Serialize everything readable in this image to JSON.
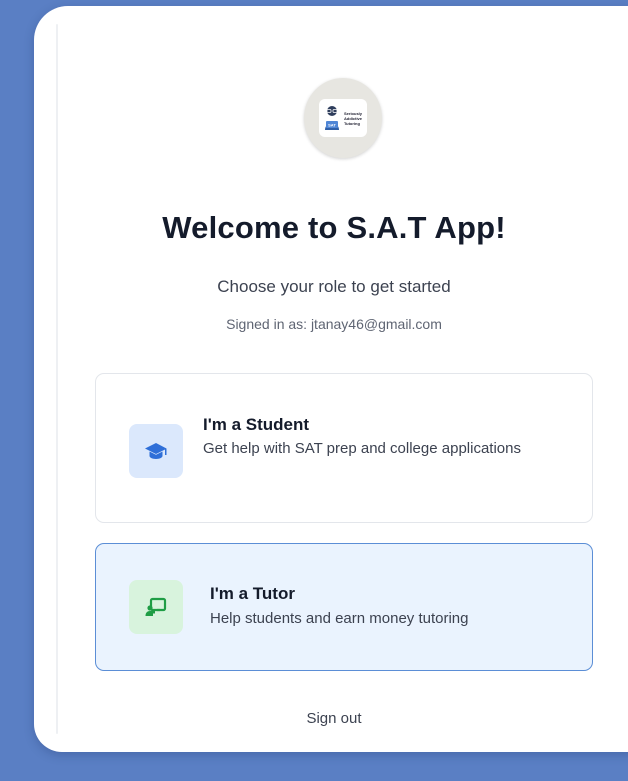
{
  "logo": {
    "text_line1": "Seriously",
    "text_line2": "Addictive",
    "text_line3": "Tutoring",
    "badge": "SAT"
  },
  "header": {
    "title": "Welcome to S.A.T App!",
    "subtitle": "Choose your role to get started",
    "signed_in": "Signed in as: jtanay46@gmail.com"
  },
  "roles": [
    {
      "title": "I'm a Student",
      "description": "Get help with SAT prep and college applications",
      "icon": "graduation-cap-icon",
      "accent": "#2f6fd8",
      "selected": false
    },
    {
      "title": "I'm a Tutor",
      "description": "Help students and earn money tutoring",
      "icon": "teacher-board-icon",
      "accent": "#1f9d45",
      "selected": true
    }
  ],
  "footer": {
    "sign_out": "Sign out"
  },
  "colors": {
    "background": "#5a7fc4",
    "selected_border": "#5b8ed6",
    "selected_fill": "#eaf3fe"
  }
}
